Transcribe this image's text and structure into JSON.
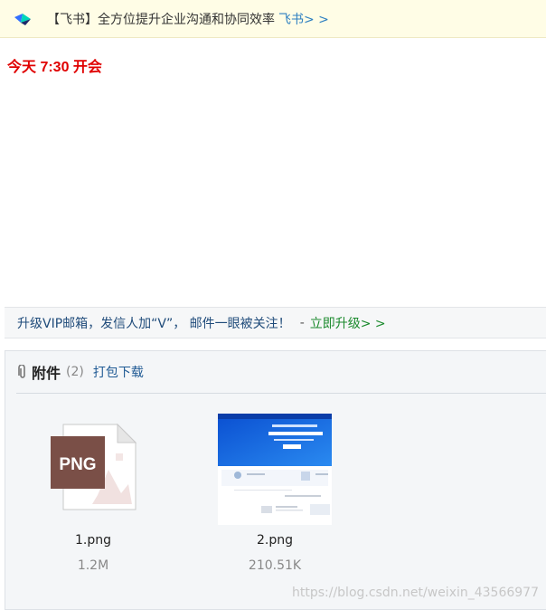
{
  "ad_banner": {
    "text": "【飞书】全方位提升企业沟通和协同效率",
    "link_label": "飞书> >"
  },
  "mail": {
    "body_text": "今天 7:30 开会"
  },
  "vip_bar": {
    "text": "升级VIP邮箱，发信人加“V”， 邮件一眼被关注！",
    "separator": "-",
    "link_label": "立即升级> >"
  },
  "attachments": {
    "title": "附件",
    "count": "(2)",
    "download_all_label": "打包下载",
    "files": [
      {
        "name": "1.png",
        "size": "1.2M",
        "type_label": "PNG",
        "icon": "png-file-icon"
      },
      {
        "name": "2.png",
        "size": "210.51K",
        "icon": "image-thumbnail"
      }
    ]
  },
  "watermark": "https://blog.csdn.net/weixin_43566977",
  "colors": {
    "banner_bg": "#fffde6",
    "body_text_red": "#e00000",
    "vip_link_green": "#1b8a2d",
    "link_blue": "#2d7fc1",
    "png_badge_brown": "#7a4f47"
  }
}
